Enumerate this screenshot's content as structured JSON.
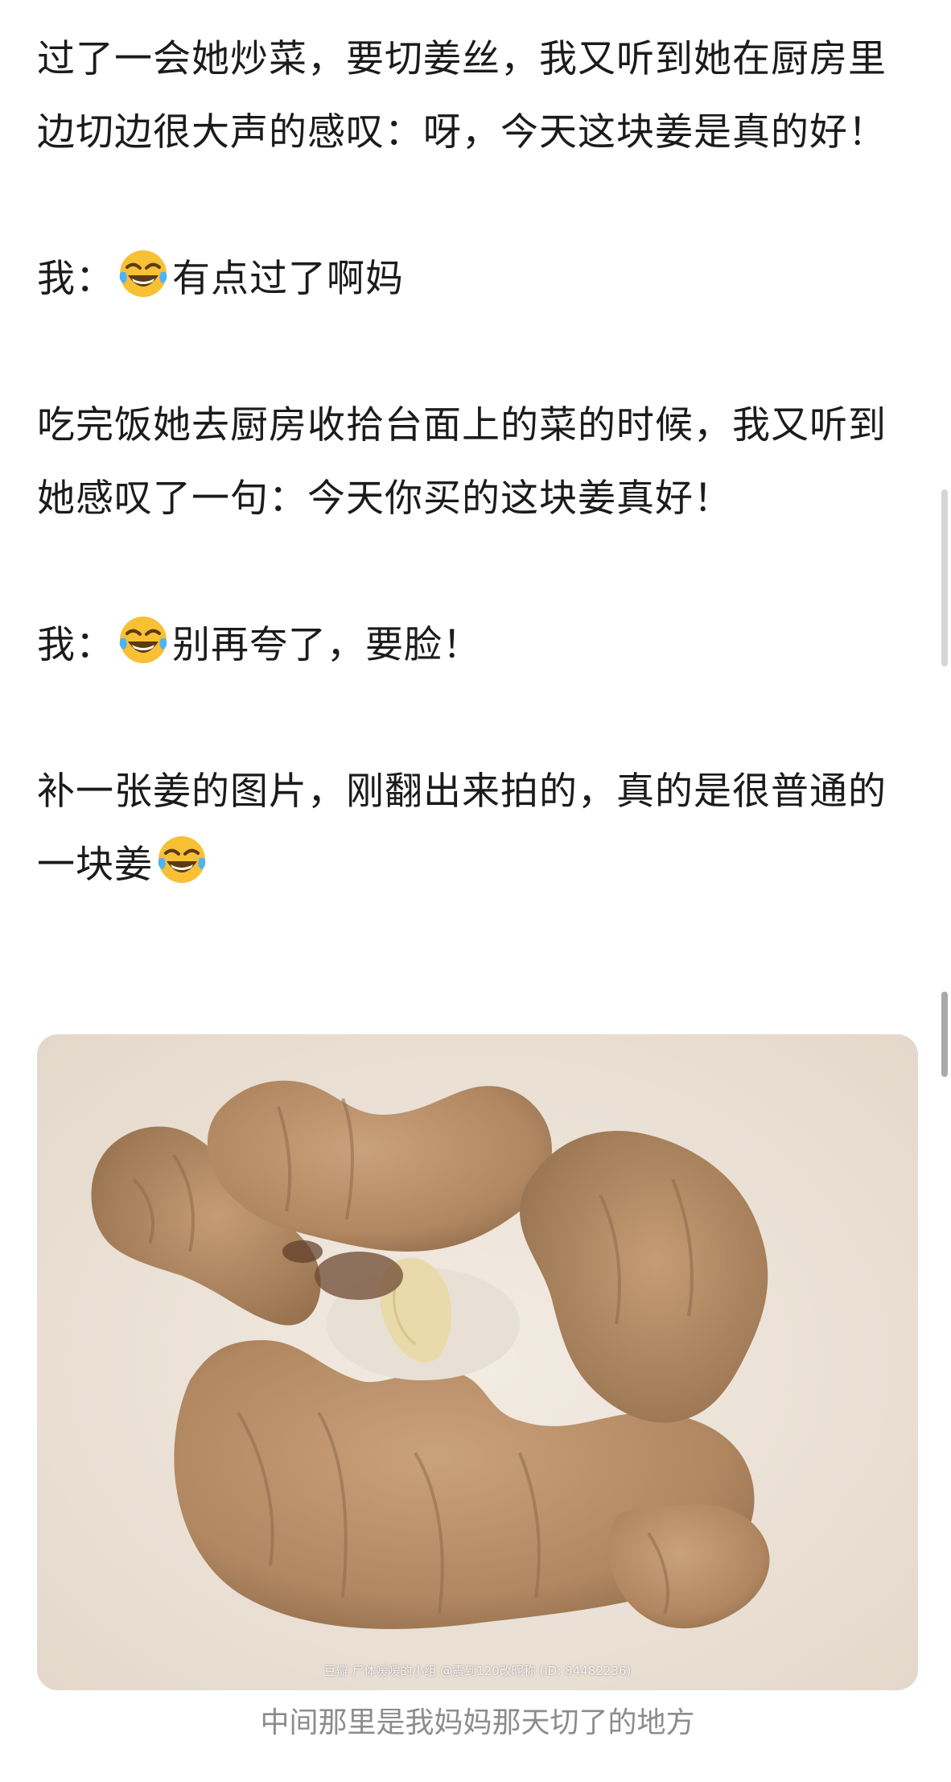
{
  "article": {
    "paragraphs": [
      {
        "text": "过了一会她炒菜，要切姜丝，我又听到她在厨房里边切边很大声的感叹：呀，今天这块姜是真的好！"
      },
      {
        "prefix": "我：",
        "emoji": "face-with-tears-of-joy",
        "suffix": "有点过了啊妈"
      },
      {
        "text": "吃完饭她去厨房收拾台面上的菜的时候，我又听到她感叹了一句：今天你买的这块姜真好！"
      },
      {
        "prefix": "我：",
        "emoji": "face-with-tears-of-joy",
        "suffix": "别再夸了，要脸！"
      },
      {
        "text": "补一张姜的图片，刚翻出来拍的，真的是很普通的一块姜",
        "emoji": "face-with-tears-of-joy"
      }
    ]
  },
  "photo": {
    "watermark": "豆瓣  尸体嗳嗳的小组 @震到120改昵称 (ID: 84482236)",
    "caption": "中间那里是我妈妈那天切了的地方",
    "background_color": "#efe7dd",
    "ginger_color": "#b58c68"
  }
}
